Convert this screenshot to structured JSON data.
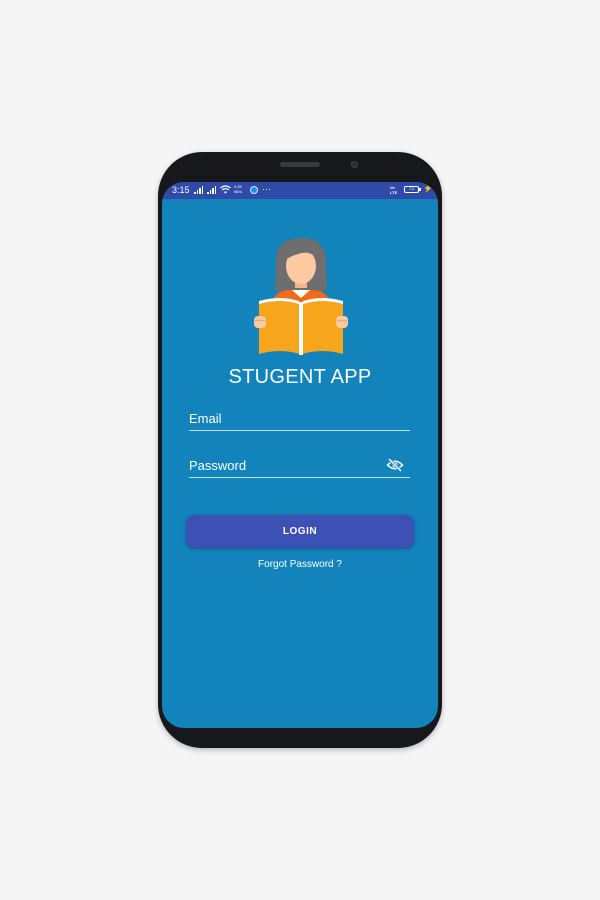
{
  "status_bar": {
    "time": "3:15",
    "speed_value": "0.25",
    "speed_unit": "kB/s",
    "overflow": "···",
    "volte_top": "Vo",
    "volte_bottom": "LTE",
    "battery_percent": "71",
    "charging_symbol": "⚡"
  },
  "login_screen": {
    "app_title": "STUGENT APP",
    "email_placeholder": "Email",
    "password_placeholder": "Password",
    "login_label": "LOGIN",
    "forgot_password_label": "Forgot Password ?"
  },
  "colors": {
    "screen_background": "#1283bb",
    "status_bar": "#2f4aa7",
    "button": "#3d51b5",
    "book": "#f7a51c",
    "hair": "#6e6e6e",
    "skin": "#fcc9a0"
  },
  "icons": {
    "password_visibility": "eye-off-icon",
    "wifi": "wifi-icon",
    "signal": "signal-icon",
    "battery": "battery-icon"
  }
}
